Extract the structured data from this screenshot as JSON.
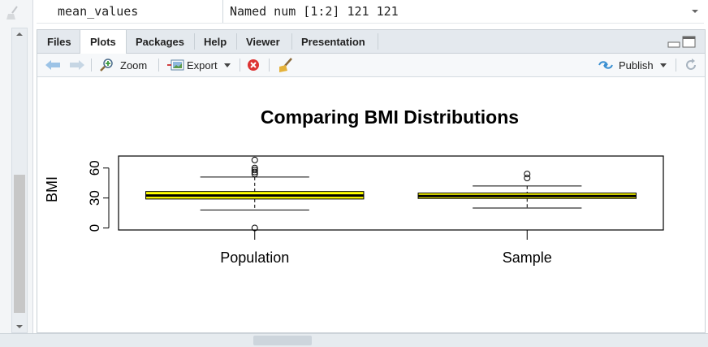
{
  "environment": {
    "row": {
      "name": "mean_values",
      "value": "Named num [1:2] 121 121"
    }
  },
  "pane": {
    "tabs": [
      {
        "label": "Files",
        "active": false
      },
      {
        "label": "Plots",
        "active": true
      },
      {
        "label": "Packages",
        "active": false
      },
      {
        "label": "Help",
        "active": false
      },
      {
        "label": "Viewer",
        "active": false
      },
      {
        "label": "Presentation",
        "active": false
      }
    ],
    "toolbar": {
      "zoom_label": "Zoom",
      "export_label": "Export",
      "publish_label": "Publish"
    }
  },
  "chart_data": {
    "type": "boxplot",
    "title": "Comparing BMI Distributions",
    "ylabel": "BMI",
    "xlabel": "",
    "categories": [
      "Population",
      "Sample"
    ],
    "yticks": [
      0,
      30,
      60
    ],
    "ylim": [
      -2,
      72
    ],
    "box_fill": "#ffff00",
    "series": [
      {
        "name": "Population",
        "min": 18,
        "q1": 29,
        "median": 32.5,
        "q3": 36.5,
        "max": 51,
        "outliers": [
          0,
          54,
          56,
          58,
          60,
          68
        ]
      },
      {
        "name": "Sample",
        "min": 20,
        "q1": 29.5,
        "median": 32,
        "q3": 35,
        "max": 42,
        "outliers": [
          50,
          54
        ]
      }
    ]
  }
}
